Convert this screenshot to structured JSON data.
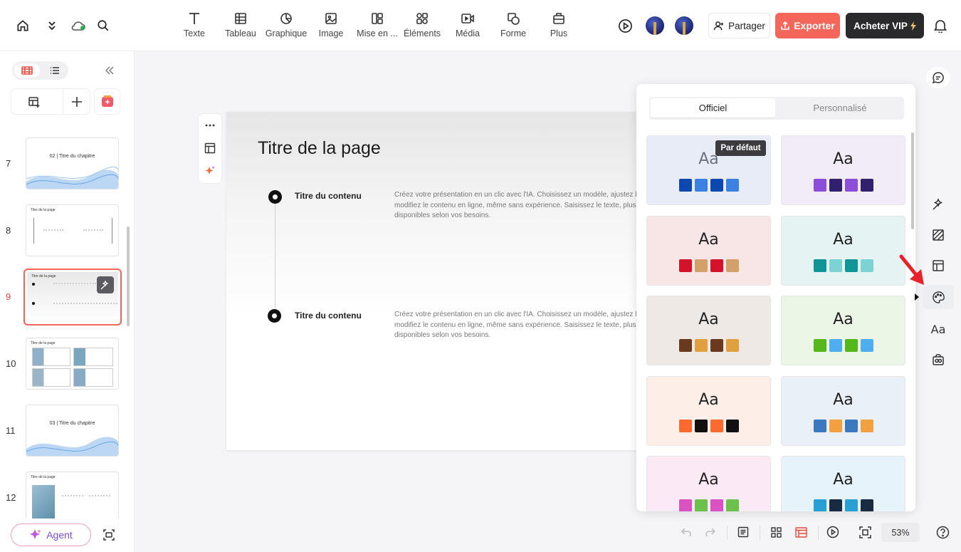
{
  "toolbar": {
    "tools": [
      {
        "id": "text",
        "label": "Texte",
        "icon": "text-icon"
      },
      {
        "id": "table",
        "label": "Tableau",
        "icon": "table-icon"
      },
      {
        "id": "chart",
        "label": "Graphique",
        "icon": "chart-icon"
      },
      {
        "id": "image",
        "label": "Image",
        "icon": "image-icon"
      },
      {
        "id": "layout",
        "label": "Mise en ...",
        "icon": "layout-icon"
      },
      {
        "id": "elements",
        "label": "Éléments",
        "icon": "elements-icon"
      },
      {
        "id": "media",
        "label": "Média",
        "icon": "media-icon"
      },
      {
        "id": "shape",
        "label": "Forme",
        "icon": "shape-icon"
      },
      {
        "id": "more",
        "label": "Plus",
        "icon": "toolbox-icon"
      }
    ],
    "share_label": "Partager",
    "export_label": "Exporter",
    "vip_label": "Acheter VIP"
  },
  "sidebar": {
    "slides": [
      {
        "num": "7",
        "title": "",
        "chapter": "02 | Titre du chapitre"
      },
      {
        "num": "8",
        "title": "Titre de la page",
        "chapter": ""
      },
      {
        "num": "9",
        "title": "Titre de la page",
        "chapter": ""
      },
      {
        "num": "10",
        "title": "Titre de la page",
        "chapter": ""
      },
      {
        "num": "11",
        "title": "",
        "chapter": "03 | Titre du chapitre"
      },
      {
        "num": "12",
        "title": "Titre de la page",
        "chapter": ""
      }
    ],
    "agent_label": "Agent"
  },
  "slide": {
    "title": "Titre de la page",
    "items": [
      {
        "title": "Titre du contenu",
        "body": "Créez votre présentation en un clic avec l'IA. Choisissez un modèle, ajustez la page et modifiez le contenu en ligne, même sans expérience. Saisissez le texte, plusieurs formats sont disponibles selon vos besoins."
      },
      {
        "title": "Titre du contenu",
        "body": "Créez votre présentation en un clic avec l'IA. Choisissez un modèle, ajustez la page et modifiez le contenu en ligne, même sans expérience. Saisissez le texte, plusieurs formats sont disponibles selon vos besoins."
      }
    ]
  },
  "theme_panel": {
    "tabs": [
      "Officiel",
      "Personnalisé"
    ],
    "active_tab": "Officiel",
    "tooltip": "Par défaut",
    "themes": [
      {
        "sample": "Aa",
        "bg": "#e8ecf6",
        "swatches": [
          "#0b48b0",
          "#3b82e0",
          "#0b48b0",
          "#3b82e0"
        ]
      },
      {
        "sample": "Aa",
        "bg": "#f1ecf8",
        "swatches": [
          "#8e4fd8",
          "#30206e",
          "#8e4fd8",
          "#30206e"
        ]
      },
      {
        "sample": "Aa",
        "bg": "#f8e6e7",
        "swatches": [
          "#d4122a",
          "#d4a06a",
          "#d4122a",
          "#d4a06a"
        ]
      },
      {
        "sample": "Aa",
        "bg": "#e6f3f3",
        "swatches": [
          "#0f9596",
          "#7dd3d4",
          "#0f9596",
          "#7dd3d4"
        ]
      },
      {
        "sample": "Aa",
        "bg": "#efe9e6",
        "swatches": [
          "#6a3a1f",
          "#e0a040",
          "#6a3a1f",
          "#e0a040"
        ]
      },
      {
        "sample": "Aa",
        "bg": "#ebf6e6",
        "swatches": [
          "#54b81a",
          "#4eaef0",
          "#54b81a",
          "#4eaef0"
        ]
      },
      {
        "sample": "Aa",
        "bg": "#fdeee8",
        "swatches": [
          "#fd6a30",
          "#111111",
          "#fd6a30",
          "#111111"
        ]
      },
      {
        "sample": "Aa",
        "bg": "#eaf0f8",
        "swatches": [
          "#3b78c0",
          "#f5a040",
          "#3b78c0",
          "#f5a040"
        ]
      },
      {
        "sample": "Aa",
        "bg": "#fbeaf5",
        "swatches": [
          "#d852c0",
          "#6cc04e",
          "#d852c0",
          "#6cc04e"
        ]
      },
      {
        "sample": "Aa",
        "bg": "#e6f3fa",
        "swatches": [
          "#28a0d4",
          "#1a2a40",
          "#28a0d4",
          "#1a2a40"
        ]
      }
    ]
  },
  "zoom": "53%",
  "colors": {
    "accent": "#f4665a",
    "vip_bg": "#2a2a2d",
    "selected_border": "#f4665a"
  }
}
